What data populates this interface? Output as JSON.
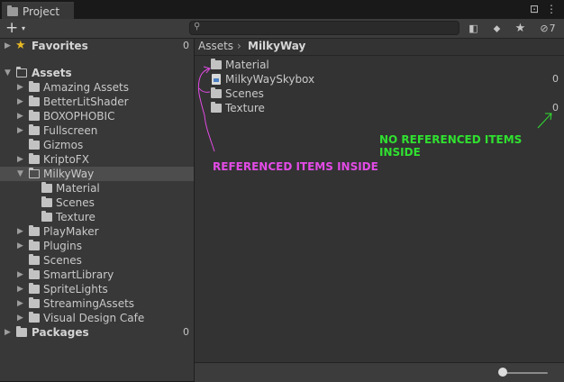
{
  "window": {
    "tab_title": "Project",
    "lock_glyph": "⊡",
    "menu_glyph": "⋮"
  },
  "toolbar": {
    "create_glyph": "+",
    "create_caret": "▾",
    "search_value": "",
    "hidden_count": "7"
  },
  "tree": {
    "favorites": {
      "label": "Favorites",
      "count": "0"
    },
    "assets": {
      "label": "Assets"
    },
    "items": [
      {
        "label": "Amazing Assets"
      },
      {
        "label": "BetterLitShader"
      },
      {
        "label": "BOXOPHOBIC"
      },
      {
        "label": "Fullscreen"
      },
      {
        "label": "Gizmos"
      },
      {
        "label": "KriptoFX"
      },
      {
        "label": "MilkyWay"
      },
      {
        "label": "Material"
      },
      {
        "label": "Scenes"
      },
      {
        "label": "Texture"
      },
      {
        "label": "PlayMaker"
      },
      {
        "label": "Plugins"
      },
      {
        "label": "Scenes"
      },
      {
        "label": "SmartLibrary"
      },
      {
        "label": "SpriteLights"
      },
      {
        "label": "StreamingAssets"
      },
      {
        "label": "Visual Design Cafe"
      }
    ],
    "packages": {
      "label": "Packages",
      "count": "0"
    }
  },
  "breadcrumb": {
    "root": "Assets",
    "separator": "›",
    "current": "MilkyWay"
  },
  "content": {
    "items": [
      {
        "label": "Material",
        "count": ""
      },
      {
        "label": "MilkyWaySkybox",
        "count": "0"
      },
      {
        "label": "Scenes",
        "count": ""
      },
      {
        "label": "Texture",
        "count": "0"
      }
    ]
  },
  "annotations": {
    "referenced": "REFERENCED ITEMS INSIDE",
    "no_referenced": "NO REFERENCED ITEMS INSIDE",
    "pink": "#e34be6",
    "green": "#30e030"
  }
}
